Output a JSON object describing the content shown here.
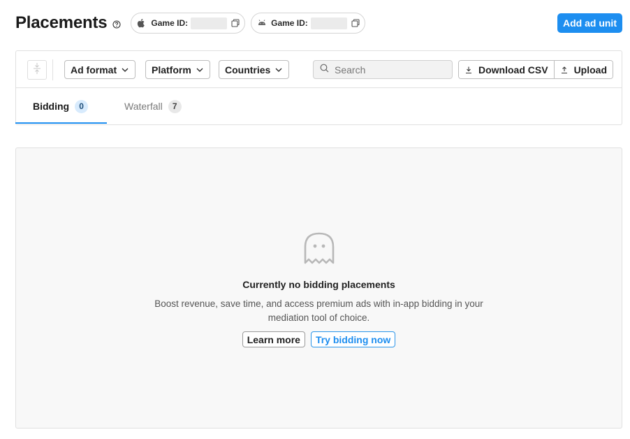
{
  "header": {
    "title": "Placements",
    "game_id_label_ios": "Game ID:",
    "game_id_label_android": "Game ID:",
    "add_button": "Add ad unit"
  },
  "toolbar": {
    "filters": [
      "Ad format",
      "Platform",
      "Countries"
    ],
    "search_placeholder": "Search",
    "download_label": "Download CSV",
    "upload_label": "Upload"
  },
  "tabs": [
    {
      "label": "Bidding",
      "count": "0",
      "active": true
    },
    {
      "label": "Waterfall",
      "count": "7",
      "active": false
    }
  ],
  "empty_state": {
    "title": "Currently no bidding placements",
    "description": "Boost revenue, save time, and access premium ads with in-app bidding in your mediation tool of choice.",
    "learn_more": "Learn more",
    "try_bidding": "Try bidding now"
  },
  "colors": {
    "accent": "#1d8ef0",
    "badge_active_bg": "#d8ebfd"
  },
  "icons": [
    "help-icon",
    "apple-icon",
    "android-icon",
    "copy-icon",
    "expand-icon",
    "chevron-down-icon",
    "search-icon",
    "download-icon",
    "upload-icon",
    "ghost-icon"
  ]
}
